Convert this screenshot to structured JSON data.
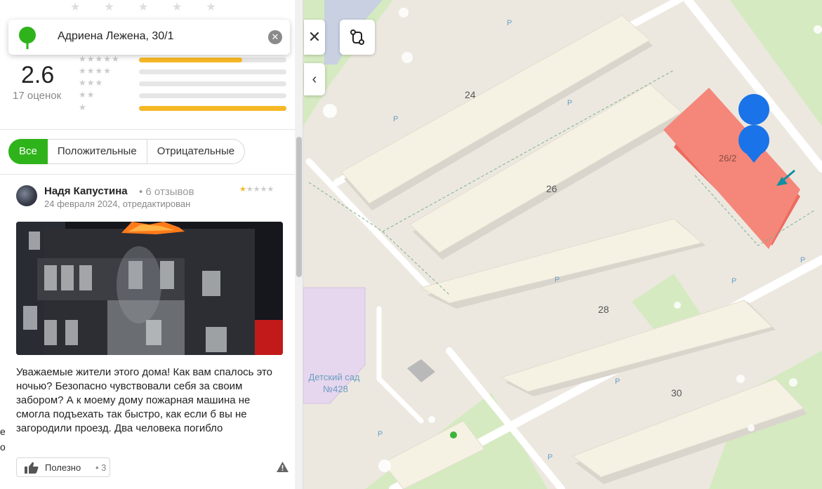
{
  "search": {
    "query": "Адриена Лежена, 30/1"
  },
  "rating": {
    "score": "2.6",
    "count_label": "17 оценок",
    "breakdown": [
      {
        "stars": "★★★★★",
        "fraction": 0.7
      },
      {
        "stars": "★★★★",
        "fraction": 0.0
      },
      {
        "stars": "★★★",
        "fraction": 0.0
      },
      {
        "stars": "★★",
        "fraction": 0.0
      },
      {
        "stars": "★",
        "fraction": 1.0
      }
    ]
  },
  "filters": [
    "Все",
    "Положительные",
    "Отрицательные"
  ],
  "review": {
    "author": "Надя Капустина",
    "author_reviews": "6 отзывов",
    "rating": 1,
    "date": "24 февраля 2024, отредактирован",
    "text": "Уважаемые жители этого дома! Как вам спалось это ночью? Безопасно чувствовали себя за своим забором? А к моему дому пожарная машина не смогла подъехать так быстро, как если б вы не загородили проезд. Два человека погибло",
    "useful_label": "Полезно",
    "useful_count": "3"
  },
  "map": {
    "house_numbers": [
      "24",
      "26",
      "28",
      "30"
    ],
    "selected_house": "26/2",
    "parking_label": "P",
    "kindergarten": {
      "line1": "Детский сад",
      "line2": "№428"
    },
    "colors": {
      "selected_building": "#f4877a",
      "pin": "#1a73e8",
      "park": "#d5eac0",
      "road": "#ffffff",
      "kindergarten": "#e6d6ee"
    }
  },
  "controls": {
    "close_glyph": "✕",
    "collapse_glyph": "‹"
  },
  "icons": {
    "search_pin": "green-pin-icon",
    "clear": "clear-icon",
    "route": "route-icon",
    "thumbs_up": "thumbs-up-icon",
    "warning": "warning-icon",
    "map_pin": "map-pin-icon",
    "entrance_arrow": "entrance-arrow-icon"
  },
  "edge_chars": [
    "е",
    "о"
  ]
}
